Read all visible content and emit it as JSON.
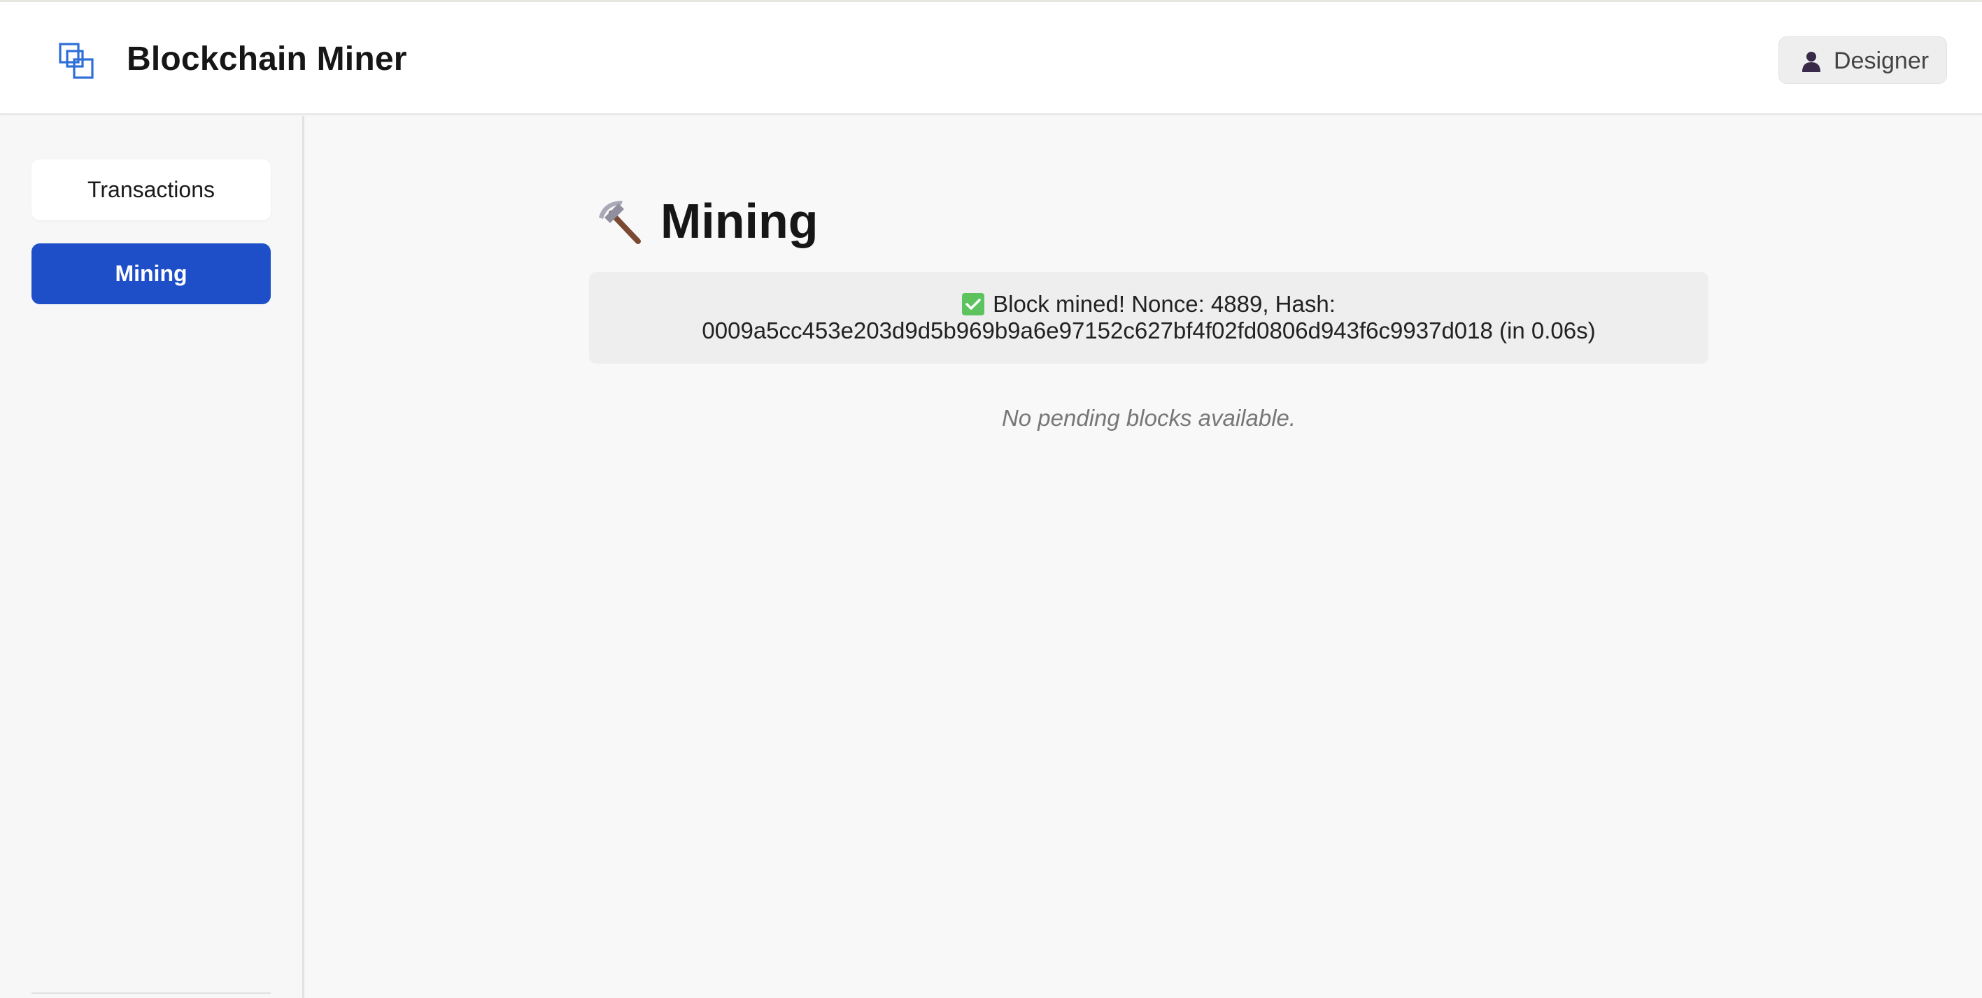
{
  "header": {
    "app_title": "Blockchain Miner",
    "logo_icon": "stacked-squares-icon",
    "user_label": "Designer",
    "user_icon": "person-icon"
  },
  "sidebar": {
    "items": [
      {
        "label": "Transactions",
        "active": false
      },
      {
        "label": "Mining",
        "active": true
      }
    ]
  },
  "main": {
    "title": "Mining",
    "title_icon": "pick-icon",
    "status": {
      "icon": "check-icon",
      "line1": "Block mined! Nonce: 4889, Hash:",
      "line2": "0009a5cc453e203d9d5b969b9a6e97152c627bf4f02fd0806d943f6c9937d018 (in 0.06s)"
    },
    "empty_message": "No pending blocks available."
  },
  "colors": {
    "accent": "#1f4fc8",
    "check_green": "#5cc35f",
    "logo_blue": "#2f6fd8"
  }
}
